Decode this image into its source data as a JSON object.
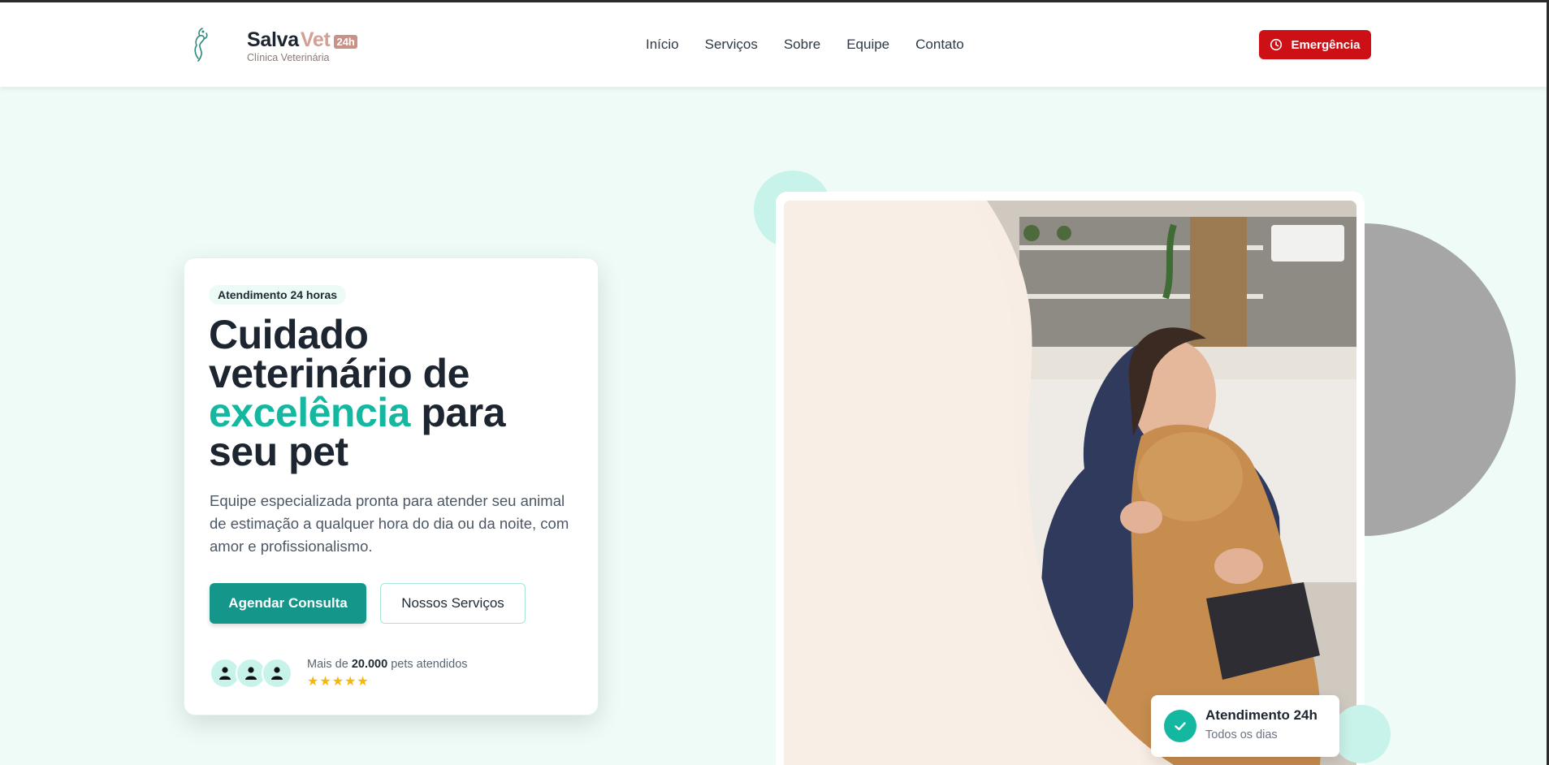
{
  "brand": {
    "name_part1": "Salva",
    "name_part2": "Vet",
    "badge": "24h",
    "subtitle": "Clínica Veterinária",
    "logo_icon": "pet-logo-icon"
  },
  "nav": {
    "items": [
      {
        "label": "Início"
      },
      {
        "label": "Serviços"
      },
      {
        "label": "Sobre"
      },
      {
        "label": "Equipe"
      },
      {
        "label": "Contato"
      }
    ],
    "emergency_label": "Emergência",
    "emergency_icon": "clock-icon"
  },
  "hero": {
    "pill": "Atendimento 24 horas",
    "headline_1": "Cuidado veterinário de",
    "headline_accent": "excelência",
    "headline_2": "para seu pet",
    "description": "Equipe especializada pronta para atender seu animal de estimação a qualquer hora do dia ou da noite, com amor e profissionalismo.",
    "primary_button": "Agendar Consulta",
    "secondary_button": "Nossos Serviços",
    "proof_prefix": "Mais de",
    "proof_count": "20.000",
    "proof_suffix": "pets atendidos",
    "stars": "★★★★★",
    "rating": 5
  },
  "badge": {
    "title": "Atendimento 24h",
    "subtitle": "Todos os dias",
    "icon": "check-icon"
  },
  "colors": {
    "accent_teal": "#14b8a0",
    "button_teal": "#15968a",
    "emergency_red": "#cc1016",
    "brand_rose": "#d39f92",
    "background_mint": "#eefbf7"
  }
}
